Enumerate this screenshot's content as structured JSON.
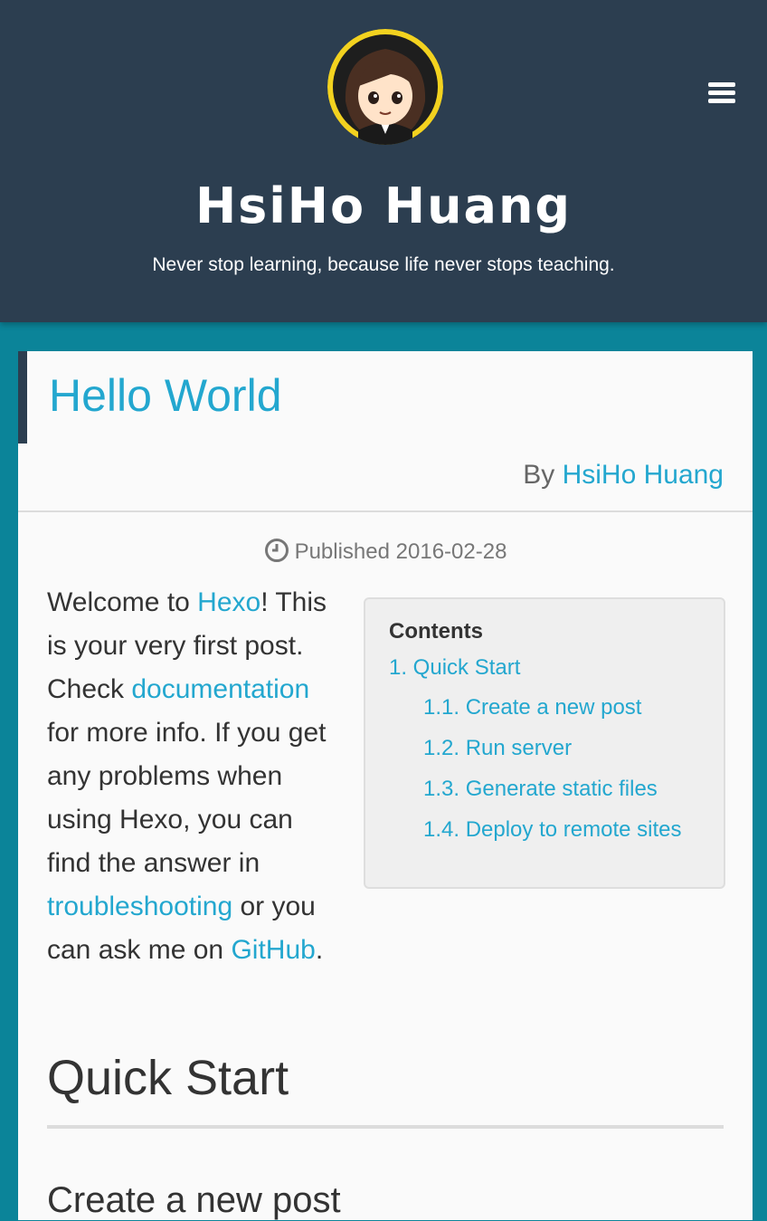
{
  "header": {
    "title": "HsiHo Huang",
    "subtitle": "Never stop learning, because life never stops teaching.",
    "colors": {
      "background": "#2c3e50",
      "page_background": "#0b8499"
    }
  },
  "menu": {
    "icon": "hamburger-menu-icon"
  },
  "post": {
    "title": "Hello World",
    "by_label": "By",
    "author": "HsiHo Huang",
    "published_label": "Published",
    "published_date": "2016-02-28",
    "intro": {
      "t1": "Welcome to ",
      "hexo": "Hexo",
      "t2": "! This is your very first post. Check ",
      "documentation": "documentation",
      "t3": " for more info. If you get any problems when using Hexo, you can find the answer in ",
      "troubleshooting": "troubleshooting",
      "t4": " or you can ask me on ",
      "github": "GitHub",
      "t5": "."
    },
    "toc": {
      "heading": "Contents",
      "items": [
        "1. Quick Start",
        "1.1. Create a new post",
        "1.2. Run server",
        "1.3. Generate static files",
        "1.4. Deploy to remote sites"
      ]
    },
    "heading_quick_start": "Quick Start",
    "heading_create_post": "Create a new post",
    "colors": {
      "link": "#23a7cf",
      "text": "#333333"
    }
  }
}
